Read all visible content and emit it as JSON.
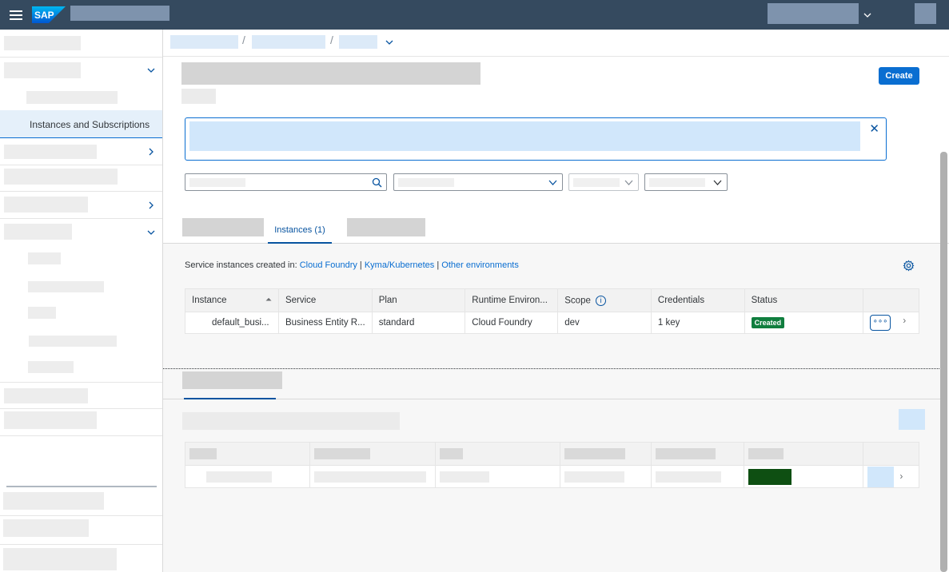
{
  "shell": {
    "logo_text": "SAP",
    "menu_icon": "hamburger-icon",
    "brand_color": "#354a5f"
  },
  "sidebar": {
    "selected_item_label": "Instances and Subscriptions"
  },
  "header": {
    "create_label": "Create"
  },
  "tabs": {
    "active_label": "Instances (1)"
  },
  "environments": {
    "prefix": "Service instances created in:",
    "links": [
      "Cloud Foundry",
      "Kyma/Kubernetes",
      "Other environments"
    ],
    "separator": "|"
  },
  "instances_table": {
    "columns": [
      "Instance",
      "Service",
      "Plan",
      "Runtime Environ...",
      "Scope",
      "Credentials",
      "Status"
    ],
    "rows": [
      {
        "instance": "default_busi...",
        "service": "Business Entity R...",
        "plan": "standard",
        "runtime": "Cloud Foundry",
        "scope": "dev",
        "credentials": "1 key",
        "status": "Created"
      }
    ]
  },
  "colors": {
    "accent": "#0a6ed1",
    "status_created": "#107e3e"
  }
}
